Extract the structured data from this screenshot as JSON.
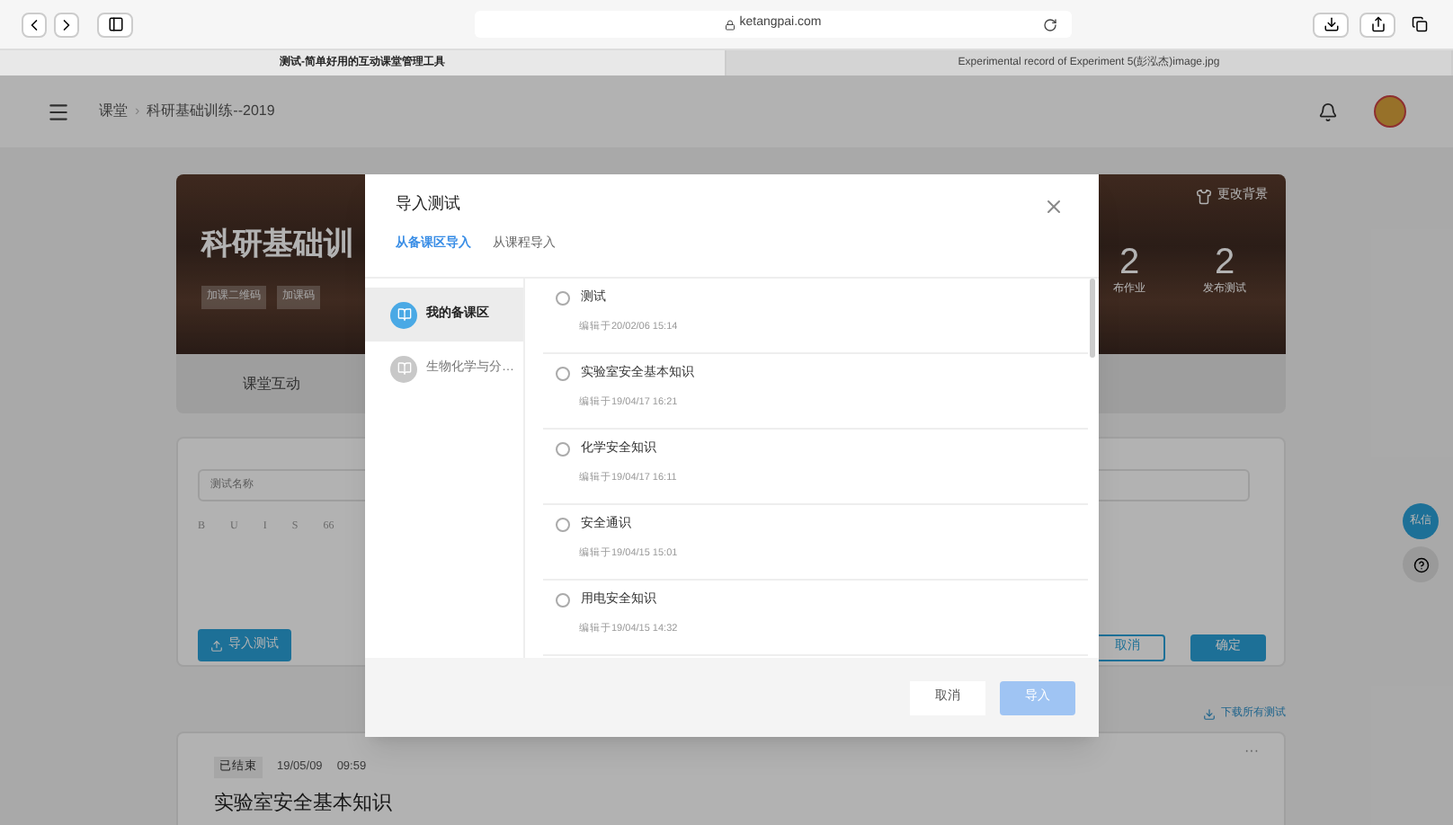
{
  "browser": {
    "address": "ketangpai.com",
    "tabs": [
      {
        "label": "测试-简单好用的互动课堂管理工具",
        "selected": true
      },
      {
        "label": "Experimental record of Experiment 5(彭泓杰)image.jpg",
        "selected": false
      }
    ]
  },
  "header": {
    "breadcrumb": [
      "课堂",
      "科研基础训练--2019"
    ],
    "separator": "›"
  },
  "course": {
    "title": "科研基础训",
    "tags": [
      "加课二维码",
      "加课码"
    ],
    "change_background": "更改背景",
    "stats": [
      {
        "value": "2",
        "label": "布作业"
      },
      {
        "value": "2",
        "label": "发布测试"
      }
    ],
    "tab": "课堂互动"
  },
  "editor": {
    "placeholder": "测试名称",
    "toolbar": [
      "B",
      "U",
      "I",
      "S",
      "66"
    ],
    "import_button": "导入测试",
    "cancel": "取消",
    "confirm": "确定"
  },
  "download_link": "下载所有测试",
  "test_card": {
    "status": "已结束",
    "date": "19/05/09",
    "time": "09:59",
    "title": "实验室安全基本知识",
    "more": "···"
  },
  "side_buttons": {
    "message": "私信"
  },
  "dialog": {
    "title": "导入测试",
    "tabs": [
      {
        "label": "从备课区导入",
        "selected": true
      },
      {
        "label": "从课程导入",
        "selected": false
      }
    ],
    "sources": [
      {
        "label": "我的备课区",
        "selected": true
      },
      {
        "label": "生物化学与分…",
        "selected": false
      }
    ],
    "items": [
      {
        "name": "测试",
        "edited": "编辑于20/02/06 15:14",
        "checked": false
      },
      {
        "name": "实验室安全基本知识",
        "edited": "编辑于19/04/17 16:21",
        "checked": false
      },
      {
        "name": "化学安全知识",
        "edited": "编辑于19/04/17 16:11",
        "checked": false
      },
      {
        "name": "安全通识",
        "edited": "编辑于19/04/15 15:01",
        "checked": false
      },
      {
        "name": "用电安全知识",
        "edited": "编辑于19/04/15 14:32",
        "checked": false
      }
    ],
    "cancel": "取消",
    "import": "导入"
  }
}
